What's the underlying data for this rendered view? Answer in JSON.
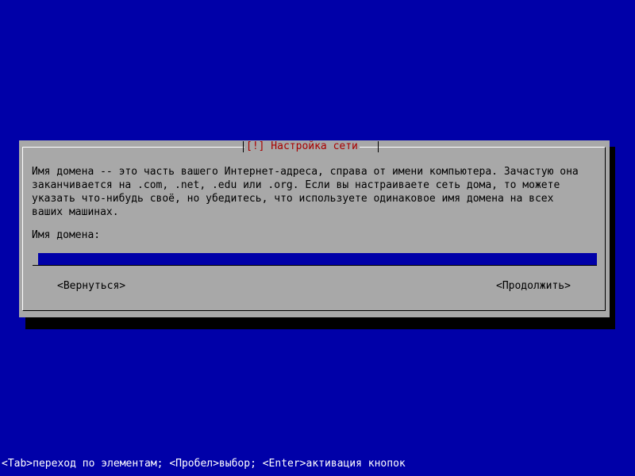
{
  "dialog": {
    "title": "[!] Настройка сети",
    "description": "Имя домена -- это часть вашего Интернет-адреса, справа от имени компьютера. Зачастую она\nзаканчивается на .com, .net, .edu или .org. Если вы настраиваете сеть дома, то можете\nуказать что-нибудь своё, но убедитесь, что используете одинаковое имя домена на всех\nваших машинах.",
    "field_label": "Имя домена:",
    "field_value": "",
    "buttons": {
      "back": "<Вернуться>",
      "continue": "<Продолжить>"
    }
  },
  "status_bar": {
    "hint": "<Tab>переход по элементам; <Пробел>выбор; <Enter>активация кнопок"
  },
  "colors": {
    "background": "#0000a8",
    "dialog": "#a8a8a8",
    "title": "#a80000",
    "input": "#0000a8",
    "status_text": "#ffffff"
  }
}
